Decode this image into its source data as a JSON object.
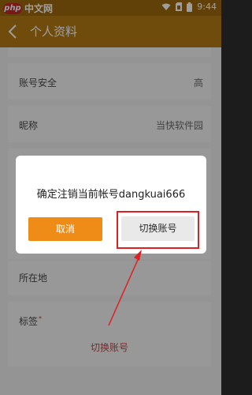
{
  "status_bar": {
    "brand_badge": "php",
    "brand_text": "中文网",
    "time": "9:44"
  },
  "app_bar": {
    "title": "个人资料"
  },
  "profile": {
    "rows": [
      {
        "label": "账号安全",
        "value": "高"
      },
      {
        "label": "昵称",
        "value": "当快软件园"
      },
      {
        "label": "所在地",
        "value": ""
      },
      {
        "label": "标签",
        "value": ""
      }
    ],
    "switch_account_label": "切换账号"
  },
  "dialog": {
    "message": "确定注销当前帐号dangkuai666",
    "cancel_label": "取消",
    "switch_label": "切换账号"
  },
  "colors": {
    "app_bar": "#b37914",
    "cancel_button": "#ef8b17",
    "highlight": "#e02020"
  }
}
